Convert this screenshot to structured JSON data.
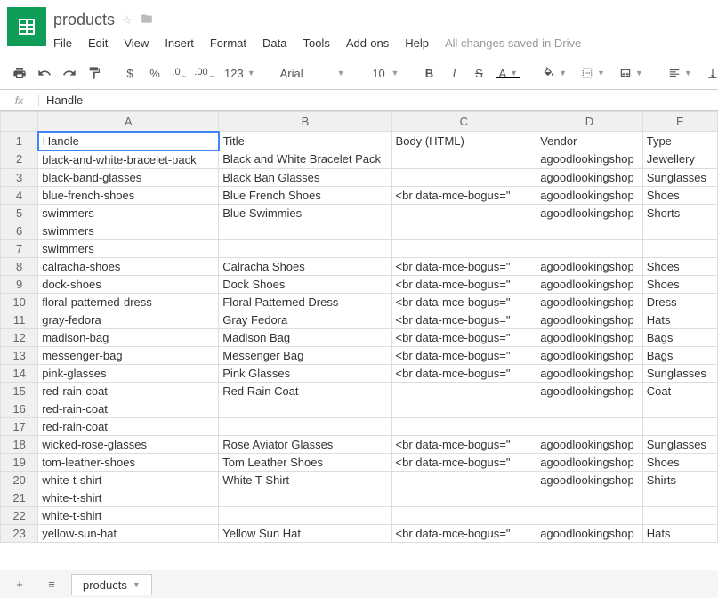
{
  "doc": {
    "title": "products",
    "save_status": "All changes saved in Drive"
  },
  "menu": [
    "File",
    "Edit",
    "View",
    "Insert",
    "Format",
    "Data",
    "Tools",
    "Add-ons",
    "Help"
  ],
  "toolbar": {
    "currency": "$",
    "percent": "%",
    "dec_less": ".0",
    "dec_more": ".00",
    "num_format": "123",
    "font": "Arial",
    "size": "10",
    "bold": "B",
    "italic": "I",
    "strike": "S",
    "text_color": "A"
  },
  "formula": {
    "label": "fx",
    "value": "Handle"
  },
  "columns": [
    "A",
    "B",
    "C",
    "D",
    "E"
  ],
  "headers": [
    "Handle",
    "Title",
    "Body (HTML)",
    "Vendor",
    "Type"
  ],
  "rows": [
    [
      "black-and-white-bracelet-pack",
      "Black and White Bracelet Pack",
      "",
      "agoodlookingshop",
      "Jewellery"
    ],
    [
      "black-band-glasses",
      "Black Ban Glasses",
      "",
      "agoodlookingshop",
      "Sunglasses"
    ],
    [
      "blue-french-shoes",
      "Blue French Shoes",
      "<br data-mce-bogus=\"",
      "agoodlookingshop",
      "Shoes"
    ],
    [
      "swimmers",
      "Blue Swimmies",
      "",
      "agoodlookingshop",
      "Shorts"
    ],
    [
      "swimmers",
      "",
      "",
      "",
      ""
    ],
    [
      "swimmers",
      "",
      "",
      "",
      ""
    ],
    [
      "calracha-shoes",
      "Calracha Shoes",
      "<br data-mce-bogus=\"",
      "agoodlookingshop",
      "Shoes"
    ],
    [
      "dock-shoes",
      "Dock Shoes",
      "<br data-mce-bogus=\"",
      "agoodlookingshop",
      "Shoes"
    ],
    [
      "floral-patterned-dress",
      "Floral Patterned Dress",
      "<br data-mce-bogus=\"",
      "agoodlookingshop",
      "Dress"
    ],
    [
      "gray-fedora",
      "Gray Fedora",
      "<br data-mce-bogus=\"",
      "agoodlookingshop",
      "Hats"
    ],
    [
      "madison-bag",
      "Madison Bag",
      "<br data-mce-bogus=\"",
      "agoodlookingshop",
      "Bags"
    ],
    [
      "messenger-bag",
      "Messenger Bag",
      "<br data-mce-bogus=\"",
      "agoodlookingshop",
      "Bags"
    ],
    [
      "pink-glasses",
      "Pink Glasses",
      "<br data-mce-bogus=\"",
      "agoodlookingshop",
      "Sunglasses"
    ],
    [
      "red-rain-coat",
      "Red Rain Coat",
      "",
      "agoodlookingshop",
      "Coat"
    ],
    [
      "red-rain-coat",
      "",
      "",
      "",
      ""
    ],
    [
      "red-rain-coat",
      "",
      "",
      "",
      ""
    ],
    [
      "wicked-rose-glasses",
      "Rose Aviator Glasses",
      "<br data-mce-bogus=\"",
      "agoodlookingshop",
      "Sunglasses"
    ],
    [
      "tom-leather-shoes",
      "Tom Leather Shoes",
      "<br data-mce-bogus=\"",
      "agoodlookingshop",
      "Shoes"
    ],
    [
      "white-t-shirt",
      "White T-Shirt",
      "",
      "agoodlookingshop",
      "Shirts"
    ],
    [
      "white-t-shirt",
      "",
      "",
      "",
      ""
    ],
    [
      "white-t-shirt",
      "",
      "",
      "",
      ""
    ],
    [
      "yellow-sun-hat",
      "Yellow Sun Hat",
      "<br data-mce-bogus=\"",
      "agoodlookingshop",
      "Hats"
    ]
  ],
  "tabs": {
    "active": "products"
  }
}
